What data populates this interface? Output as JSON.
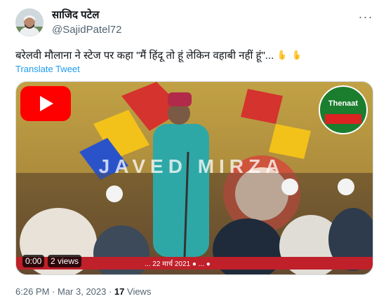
{
  "author": {
    "name": "साजिद पटेल",
    "handle": "@SajidPatel72"
  },
  "tweet": {
    "text": "बरेलवी मौलाना ने स्टेज पर कहा \"मैं हिंदू तो हूं लेकिन वहाबी नहीं हूं\"...",
    "emojis": [
      "backhand-index-pointing-down-icon",
      "backhand-index-pointing-down-icon"
    ],
    "translate_label": "Translate Tweet"
  },
  "video": {
    "watermark": "JAVED MIRZA",
    "channel_logo": "Thenaat",
    "caption_strip": "... 22 मार्च 2021 ● ... ●",
    "elapsed": "0:00",
    "views_badge": "2 views"
  },
  "meta": {
    "time": "6:26 PM",
    "sep": " · ",
    "date": "Mar 3, 2023",
    "views_count": "17",
    "views_label": " Views"
  },
  "colors": {
    "accent": "#1d9bf0",
    "secondary_text": "#536471",
    "youtube_red": "#ff0000"
  }
}
